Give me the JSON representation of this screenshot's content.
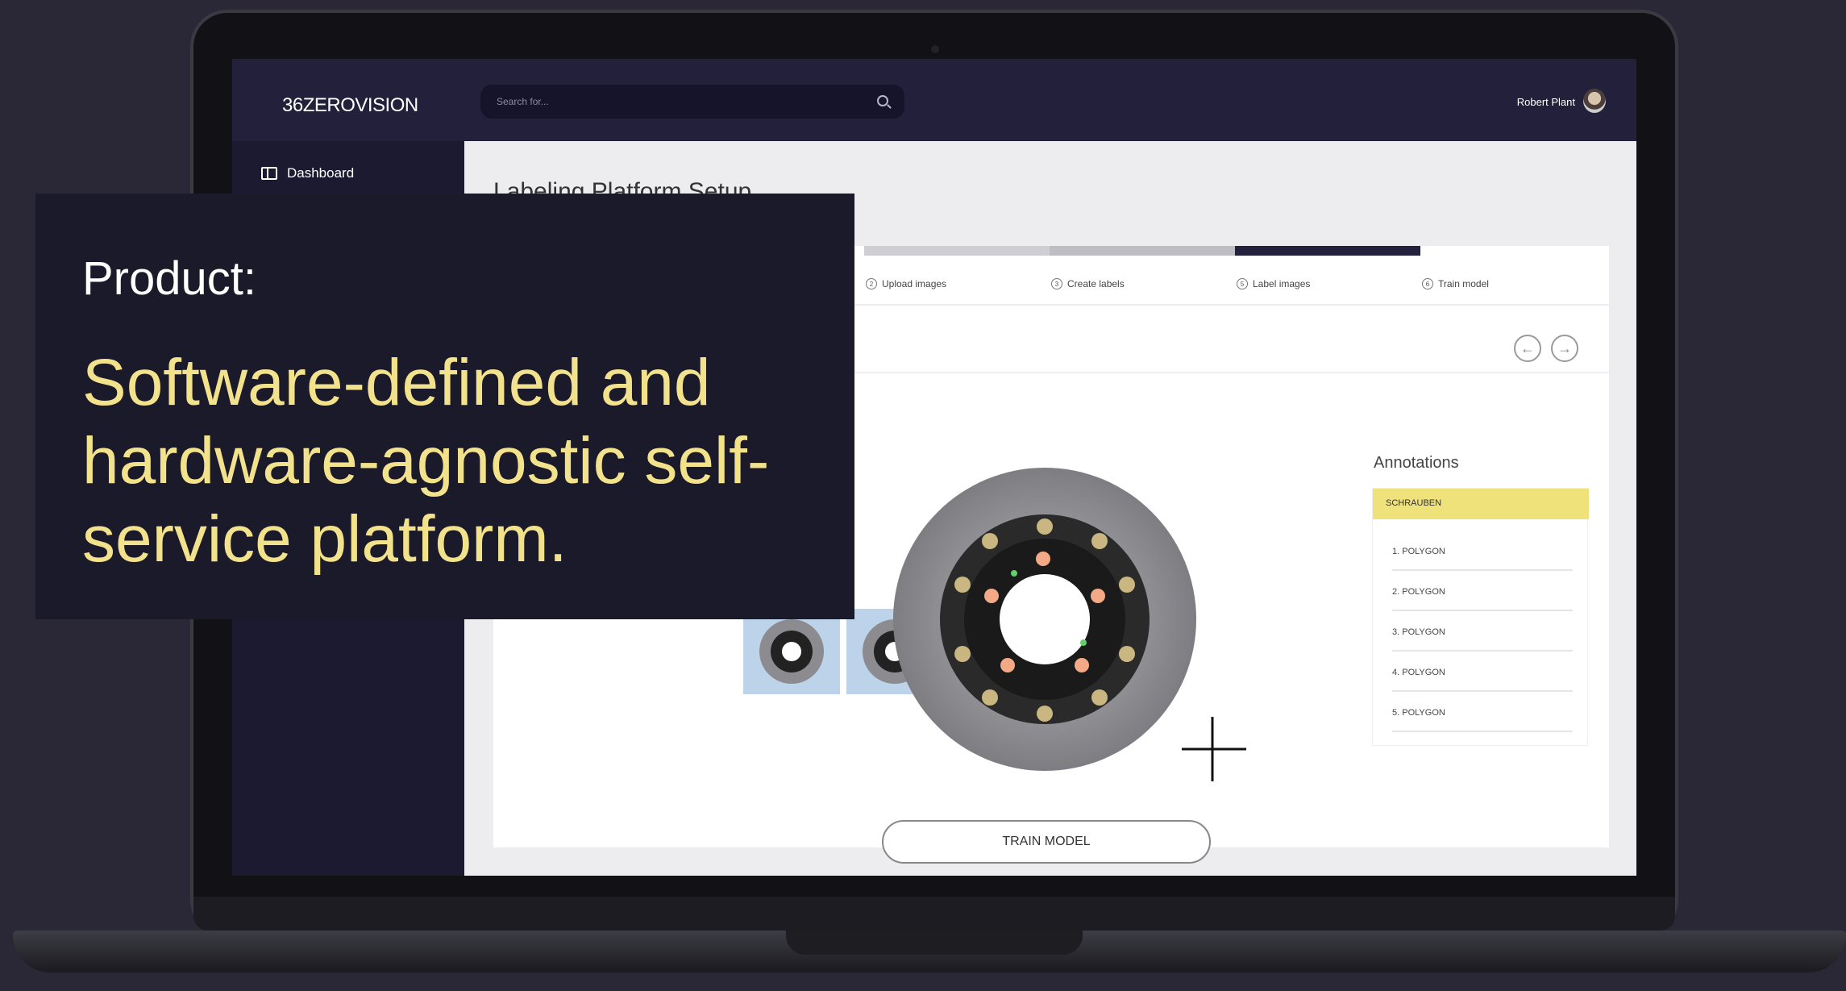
{
  "app": {
    "logo": "36ZEROVISION",
    "user_name": "Robert Plant"
  },
  "search": {
    "placeholder": "Search for..."
  },
  "sidebar": {
    "items": [
      {
        "label": "Dashboard",
        "icon": "dashboard-icon"
      }
    ]
  },
  "main": {
    "title": "Labeling Platform Setup",
    "steps": [
      {
        "num": "2",
        "label": "Upload images"
      },
      {
        "num": "3",
        "label": "Create labels"
      },
      {
        "num": "5",
        "label": "Label images"
      },
      {
        "num": "6",
        "label": "Train model"
      }
    ],
    "current_step": 3,
    "train_button": "TRAIN MODEL",
    "annotations": {
      "title": "Annotations",
      "group": "SCHRAUBEN",
      "items": [
        "1. POLYGON",
        "2. POLYGON",
        "3. POLYGON",
        "4. POLYGON",
        "5. POLYGON"
      ]
    }
  },
  "overlay": {
    "label": "Product:",
    "headline": "Software-defined and hardware-agnostic self-service platform."
  },
  "colors": {
    "accent_yellow": "#f3e28c",
    "topbar": "#22203a",
    "sidebar": "#1b1a30",
    "progress_active": "#22203a",
    "annotation_header": "#efe27a"
  }
}
